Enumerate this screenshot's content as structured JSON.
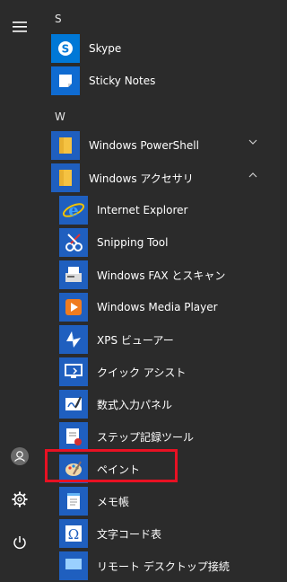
{
  "sections": {
    "s": "S",
    "w": "W"
  },
  "apps": {
    "skype": "Skype",
    "sticky": "Sticky Notes",
    "powershell": "Windows PowerShell",
    "accessories": "Windows アクセサリ",
    "ie": "Internet Explorer",
    "snipping": "Snipping Tool",
    "fax": "Windows FAX とスキャン",
    "wmp": "Windows Media Player",
    "xps": "XPS ビューアー",
    "quickassist": "クイック アシスト",
    "math": "数式入力パネル",
    "steps": "ステップ記録ツール",
    "paint": "ペイント",
    "notepad": "メモ帳",
    "charmap": "文字コード表",
    "rdp": "リモート デスクトップ接続"
  },
  "colors": {
    "highlight": "#e81123",
    "folder": "#f5c242",
    "tile": "#1f5fbf"
  }
}
